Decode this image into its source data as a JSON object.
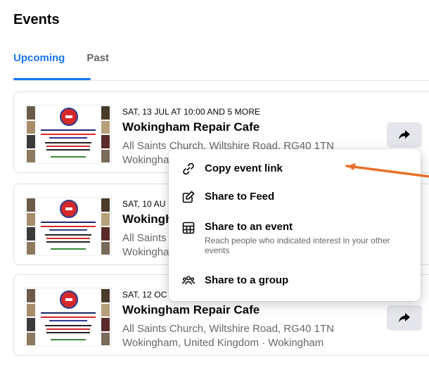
{
  "page": {
    "title": "Events"
  },
  "tabs": [
    {
      "label": "Upcoming",
      "active": true
    },
    {
      "label": "Past",
      "active": false
    }
  ],
  "events": [
    {
      "date": "SAT, 13 JUL AT 10:00 AND 5 MORE",
      "title": "Wokingham Repair Cafe",
      "location_line1": "All Saints Church, Wiltshire Road, RG40 1TN",
      "location_line2": "Wokingha"
    },
    {
      "date": "SAT, 10 AU",
      "title": "Wokingh",
      "location_line1": "All Saints",
      "location_line2": "Wokingha"
    },
    {
      "date": "SAT, 12 OC",
      "title": "Wokingham Repair Cafe",
      "location_line1": "All Saints Church, Wiltshire Road, RG40 1TN",
      "location_line2": "Wokingham, United Kingdom · Wokingham"
    }
  ],
  "share_menu": {
    "items": [
      {
        "label": "Copy event link",
        "icon": "link-icon"
      },
      {
        "label": "Share to Feed",
        "icon": "compose-icon"
      },
      {
        "label": "Share to an event",
        "icon": "calendar-grid-icon",
        "description": "Reach people who indicated interest in your other events"
      },
      {
        "label": "Share to a group",
        "icon": "group-icon"
      }
    ]
  },
  "colors": {
    "accent": "#1877f2",
    "annotation_arrow": "#e8702a",
    "secondary_text": "#65676b"
  }
}
